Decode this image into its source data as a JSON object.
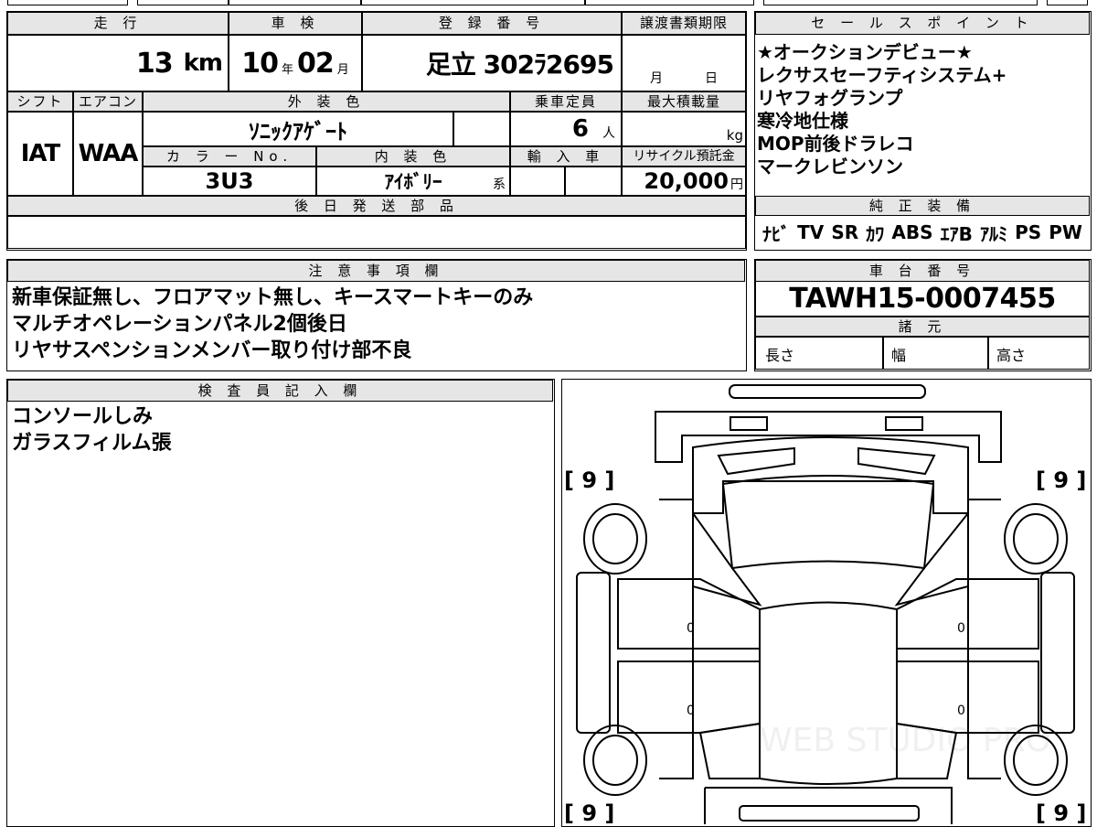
{
  "top_row": {
    "mileage_header": "走 行",
    "mileage_value": "13",
    "mileage_unit": "km",
    "inspection_header": "車 検",
    "inspection_year": "10",
    "inspection_year_unit": "年",
    "inspection_month": "02",
    "inspection_month_unit": "月",
    "registration_header": "登 録 番 号",
    "registration_value": "足立 302ﾗ2695",
    "transfer_header": "譲渡書類期限",
    "transfer_month_unit": "月",
    "transfer_day_unit": "日"
  },
  "second_row": {
    "shift_header": "シフト",
    "shift_value": "IAT",
    "ac_header": "エアコン",
    "ac_value": "WAA",
    "exterior_header": "外 装 色",
    "exterior_value": "ｿﾆｯｸｱｹﾞｰﾄ",
    "capacity_header": "乗車定員",
    "capacity_value": "6",
    "capacity_unit": "人",
    "max_load_header": "最大積載量",
    "max_load_unit": "kg",
    "color_no_header": "カ ラ ー No.",
    "color_no_value": "3U3",
    "interior_header": "内 装 色",
    "interior_value": "ｱｲﾎﾞﾘｰ",
    "interior_suffix": "系",
    "import_header": "輸 入 車",
    "recycle_header": "リサイクル預託金",
    "recycle_value": "20,000",
    "recycle_unit": "円"
  },
  "later_parts": {
    "header": "後 日 発 送 部 品",
    "value": ""
  },
  "sales_points": {
    "header": "セ ー ル ス ポ イ ン ト",
    "lines": [
      "★オークションデビュー★",
      "レクサスセーフティシステム+",
      "リヤフォグランプ",
      "寒冷地仕様",
      "MOP前後ドラレコ",
      "マークレビンソン"
    ]
  },
  "genuine_equipment": {
    "header": "純 正 装 備",
    "items": [
      "ﾅﾋﾞ",
      "TV",
      "SR",
      "ｶﾜ",
      "ABS",
      "ｴｱB",
      "ｱﾙﾐ",
      "PS",
      "PW"
    ]
  },
  "notes": {
    "header": "注 意 事 項 欄",
    "lines": [
      "新車保証無し、フロアマット無し、キースマートキーのみ",
      "マルチオペレーションパネル2個後日",
      "リヤサスペンションメンバー取り付け部不良"
    ]
  },
  "chassis": {
    "header": "車 台 番 号",
    "value": "TAWH15-0007455"
  },
  "specs": {
    "header": "諸 元",
    "length": "長さ",
    "width": "幅",
    "height": "高さ"
  },
  "inspector": {
    "header": "検 査 員 記 入 欄",
    "lines": [
      "コンソールしみ",
      "ガラスフィルム張"
    ]
  },
  "diagram": {
    "tire_marks": [
      "[ 9 ]",
      "[ 9 ]",
      "[ 9 ]",
      "[ 9 ]"
    ],
    "door_marks": [
      "0",
      "0",
      "0",
      "0"
    ],
    "watermark": "WEB STUDIO PRO"
  }
}
